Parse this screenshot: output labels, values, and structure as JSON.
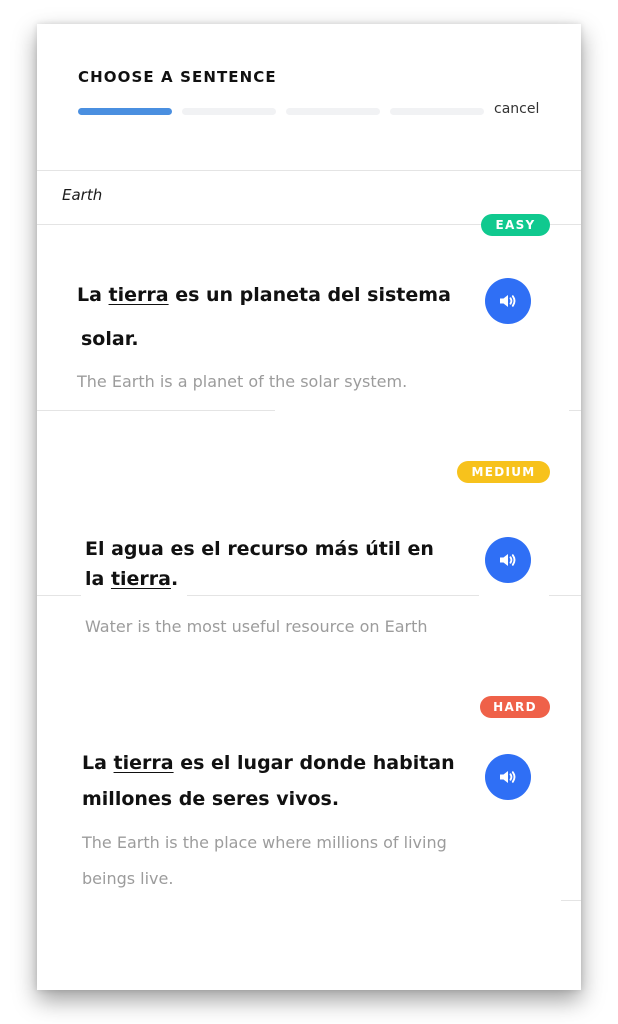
{
  "header": {
    "title": "CHOOSE A SENTENCE",
    "cancel_label": "cancel",
    "progress": {
      "current_step": 1,
      "total_steps": 4
    }
  },
  "word": "Earth",
  "sentences": [
    {
      "difficulty": "EASY",
      "badge_color": "#10c98f",
      "line1_before": "La ",
      "line1_keyword": "tierra",
      "line1_after": " es un planeta del sistema",
      "line2_before": "solar.",
      "line2_keyword": "",
      "line2_after": "",
      "translation_line1": "The Earth is a planet of the solar system.",
      "translation_line2": "",
      "audio_icon": "speaker-icon"
    },
    {
      "difficulty": "MEDIUM",
      "badge_color": "#f7c21c",
      "line1_before": "El agua es el recurso más útil en",
      "line1_keyword": "",
      "line1_after": "",
      "line2_before": "la ",
      "line2_keyword": "tierra",
      "line2_after": ".",
      "translation_line1": "Water is the most useful resource on Earth",
      "translation_line2": "",
      "audio_icon": "speaker-icon"
    },
    {
      "difficulty": "HARD",
      "badge_color": "#ef6149",
      "line1_before": "La ",
      "line1_keyword": "tierra",
      "line1_after": " es el lugar donde habitan",
      "line2_before": "millones de seres vivos.",
      "line2_keyword": "",
      "line2_after": "",
      "translation_line1": "The Earth is the place where millions of living",
      "translation_line2": "beings live.",
      "audio_icon": "speaker-icon"
    }
  ],
  "colors": {
    "progress_active": "#4a8fe0",
    "progress_inactive": "#f1f2f4",
    "audio_button": "#2f6ff5"
  }
}
